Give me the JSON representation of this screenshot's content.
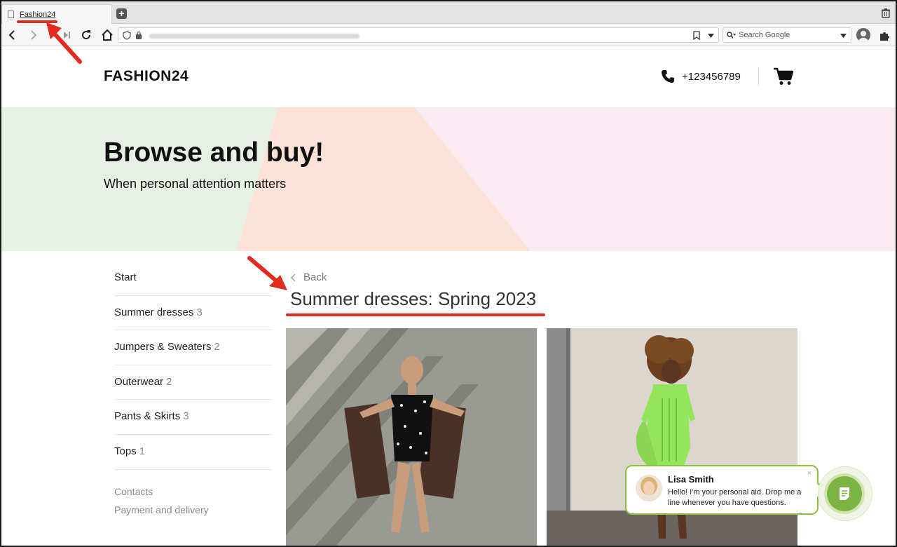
{
  "browser": {
    "tab_title": "Fashion24",
    "new_tab_label": "+",
    "search_placeholder": "Search Google"
  },
  "site": {
    "logo": "FASHION24",
    "phone": "+123456789"
  },
  "hero": {
    "title": "Browse and buy!",
    "subtitle": "When personal attention matters"
  },
  "sidebar": {
    "categories": [
      {
        "label": "Start",
        "count": ""
      },
      {
        "label": "Summer dresses",
        "count": "3"
      },
      {
        "label": "Jumpers & Sweaters",
        "count": "2"
      },
      {
        "label": "Outerwear",
        "count": "2"
      },
      {
        "label": "Pants & Skirts",
        "count": "3"
      },
      {
        "label": "Tops",
        "count": "1"
      }
    ],
    "links": [
      "Contacts",
      "Payment and delivery"
    ]
  },
  "main": {
    "back_label": "Back",
    "page_title": "Summer dresses: Spring 2023"
  },
  "chat": {
    "agent_name": "Lisa Smith",
    "message": "Hello! I'm your personal aid. Drop me a line whenever you have questions.",
    "close_glyph": "×"
  },
  "colors": {
    "accent_green": "#7cb342",
    "annotation_red": "#e02b1f"
  }
}
